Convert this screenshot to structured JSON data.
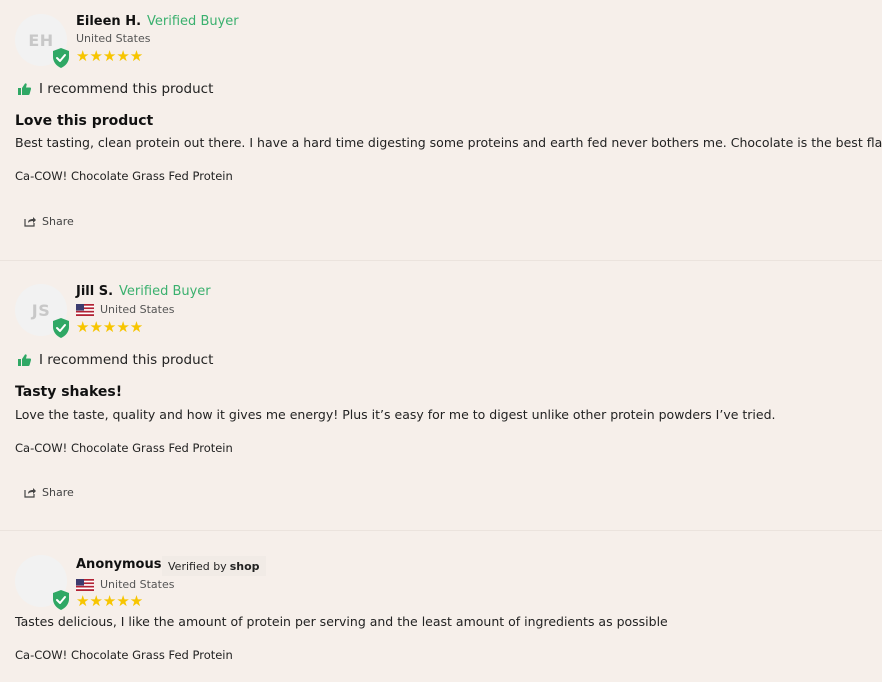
{
  "reviews": [
    {
      "initials": "EH",
      "name": "Eileen H.",
      "verified_label": "Verified Buyer",
      "location": "United States",
      "rating": 5,
      "stars": "★★★★★",
      "recommend_text": "I recommend this product",
      "title": "Love this product",
      "body": "Best tasting, clean protein out there. I have a hard time digesting some proteins and earth fed never bothers me. Chocolate is the best flavor!",
      "product": "Ca-COW! Chocolate Grass Fed Protein",
      "share_label": "Share"
    },
    {
      "initials": "JS",
      "name": "Jill S.",
      "verified_label": "Verified Buyer",
      "location": "United States",
      "rating": 5,
      "stars": "★★★★★",
      "recommend_text": "I recommend this product",
      "title": "Tasty shakes!",
      "body": "Love the taste, quality and how it gives me energy! Plus it’s easy for me to digest unlike other protein powders I’ve tried.",
      "product": "Ca-COW! Chocolate Grass Fed Protein",
      "share_label": "Share"
    },
    {
      "initials": "",
      "name": "Anonymous",
      "verified_prefix": "Verified by",
      "verified_brand": "shop",
      "location": "United States",
      "rating": 5,
      "stars": "★★★★★",
      "body": "Tastes delicious, I like the amount of protein per serving and the least amount of ingredients as possible",
      "product": "Ca-COW! Chocolate Grass Fed Protein"
    }
  ],
  "colors": {
    "background": "#f6efea",
    "verified_green": "#3ab06e",
    "star_yellow": "#f7c500",
    "shield_green": "#2fa865"
  },
  "icons": [
    "shield-check-icon",
    "thumbs-up-icon",
    "share-icon",
    "us-flag-icon",
    "star-icon"
  ]
}
